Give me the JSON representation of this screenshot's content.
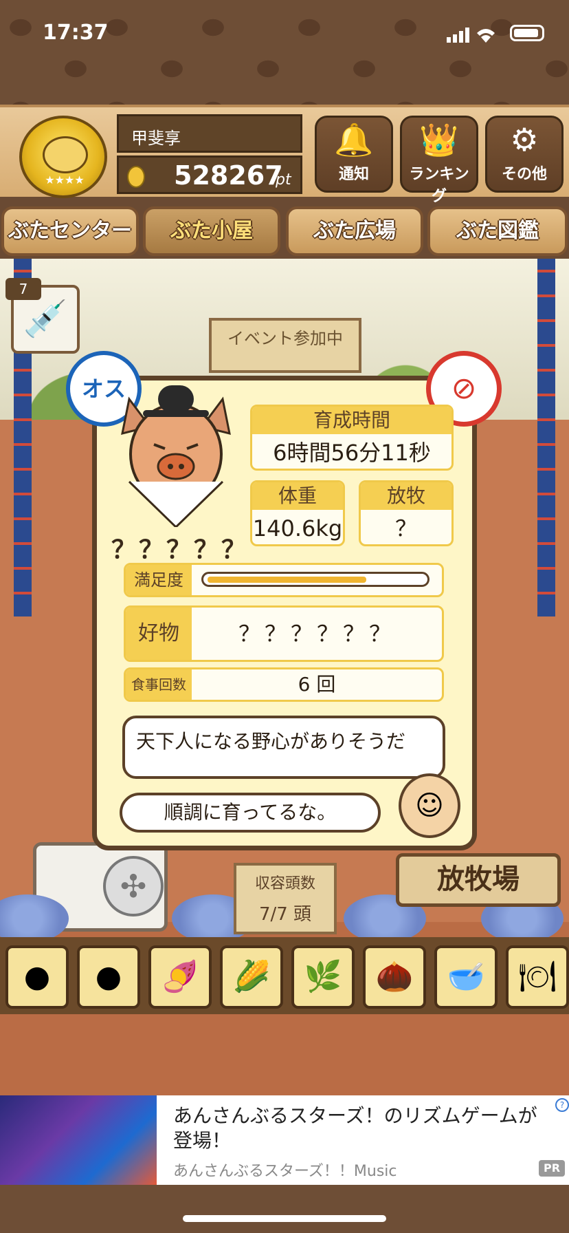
{
  "status": {
    "time": "17:37"
  },
  "header": {
    "user_name": "甲斐享",
    "points": "528267",
    "points_unit": "pt",
    "buttons": [
      {
        "label": "通知",
        "icon": "bell-icon"
      },
      {
        "label": "ランキング",
        "icon": "crown-icon"
      },
      {
        "label": "その他",
        "icon": "gear-icon"
      }
    ]
  },
  "nav": {
    "tabs": [
      "ぶたセンター",
      "ぶた小屋",
      "ぶた広場",
      "ぶた図鑑"
    ],
    "active": 1
  },
  "scene": {
    "syringe_count": "7",
    "event_board": "イベント参加中"
  },
  "pig": {
    "gender_badge": "オス",
    "name": "？？？？？",
    "stats": {
      "growth_time_label": "育成時間",
      "growth_time_value": "6時間56分11秒",
      "weight_label": "体重",
      "weight_value": "140.6kg",
      "grazing_label": "放牧",
      "grazing_value": "？"
    },
    "satisfaction_label": "満足度",
    "satisfaction_level": 0.74,
    "favorite_label": "好物",
    "favorite_value": "？？？？？？",
    "meals_label": "食事回数",
    "meals_value": "6 回",
    "comment": "天下人になる野心がありそうだ",
    "farmer_speech": "順調に育ってるな。"
  },
  "lower": {
    "capacity_label": "収容頭数",
    "capacity_value": "7/7 頭",
    "pasture_button": "放牧場"
  },
  "foods": [
    "soybeans-icon",
    "mixed-beans-icon",
    "sweet-potato-icon",
    "corn-icon",
    "ginkgo-icon",
    "acorn-icon",
    "grain-bowl-icon",
    "chestnut-plate-icon"
  ],
  "ad": {
    "title": "あんさんぶるスターズ！のリズムゲームが登場！",
    "subtitle": "あんさんぶるスターズ！！Music",
    "badge": "PR"
  },
  "colors": {
    "accent": "#f5cf52",
    "panel": "#fef6c7",
    "wood": "#5c4128"
  }
}
